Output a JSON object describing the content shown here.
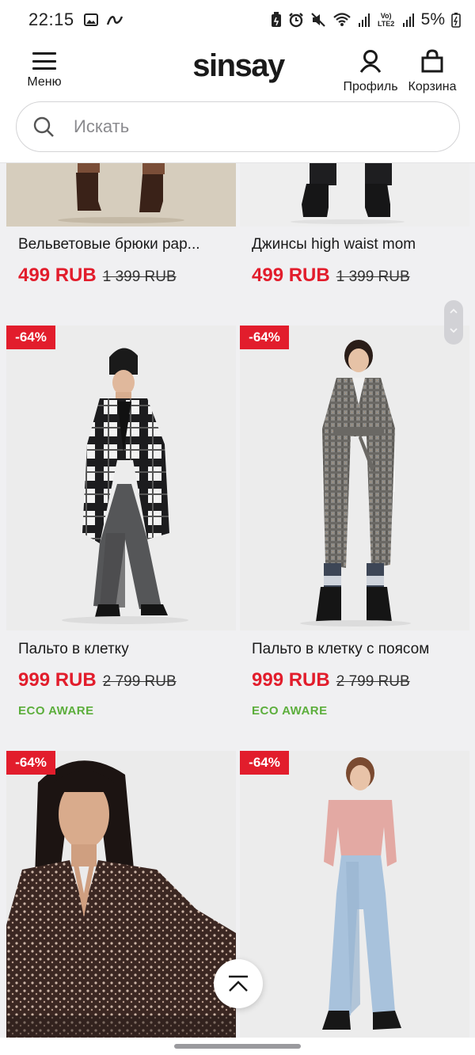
{
  "status_bar": {
    "time": "22:15",
    "battery": "5%",
    "network_label": "Vo) LTE2",
    "icons": [
      "gallery-icon",
      "wallet-icon",
      "battery-saver-icon",
      "alarm-icon",
      "mute-icon",
      "wifi-icon",
      "signal-icon",
      "battery-icon"
    ]
  },
  "header": {
    "menu_label": "Меню",
    "logo": "sinsay",
    "profile_label": "Профиль",
    "cart_label": "Корзина"
  },
  "search": {
    "placeholder": "Искать"
  },
  "products": [
    {
      "name": "Вельветовые брюки рар...",
      "price": "499 RUB",
      "old_price": "1 399 RUB",
      "badge": "",
      "eco": ""
    },
    {
      "name": "Джинсы high waist mom",
      "price": "499 RUB",
      "old_price": "1 399 RUB",
      "badge": "",
      "eco": ""
    },
    {
      "name": "Пальто в клетку",
      "price": "999 RUB",
      "old_price": "2 799 RUB",
      "badge": "-64%",
      "eco": "ECO AWARE"
    },
    {
      "name": "Пальто в клетку с поясом",
      "price": "999 RUB",
      "old_price": "2 799 RUB",
      "badge": "-64%",
      "eco": "ECO AWARE"
    },
    {
      "badge": "-64%"
    },
    {
      "badge": "-64%"
    }
  ],
  "colors": {
    "sale_red": "#e21d2c",
    "eco_green": "#5cae3c",
    "page_bg": "#f0f0f2"
  }
}
